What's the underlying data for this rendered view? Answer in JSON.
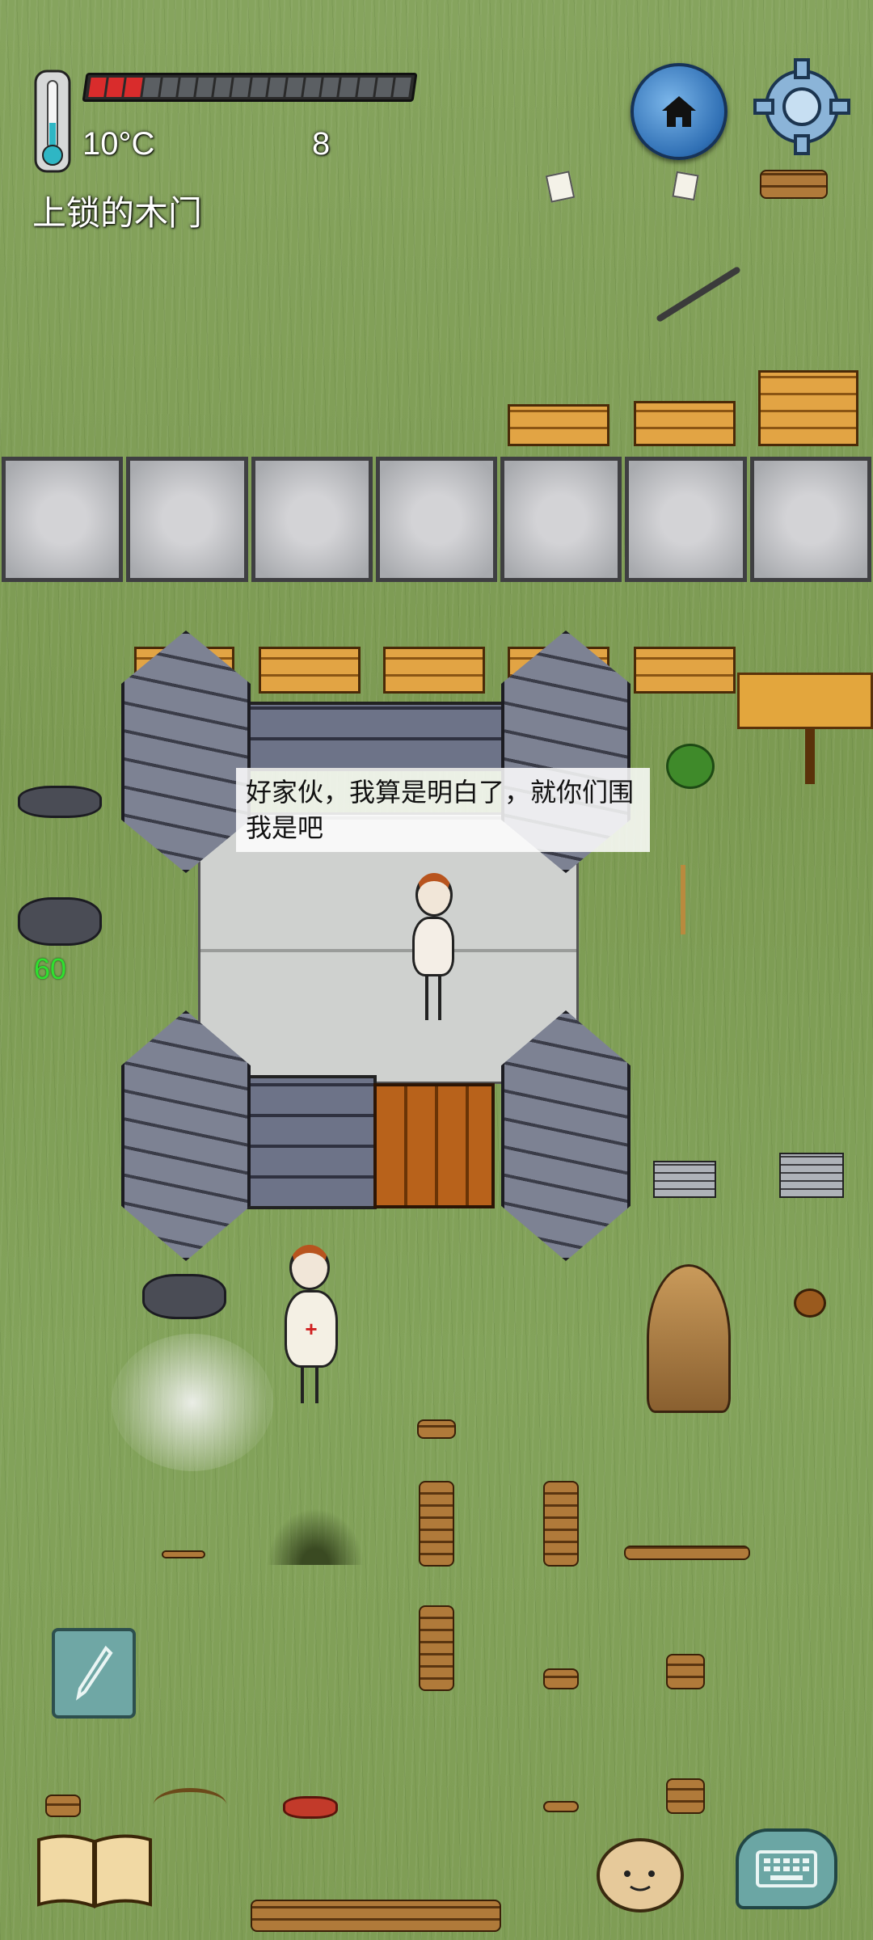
{
  "hud": {
    "temperature": "10°C",
    "count": "8",
    "object_name": "上锁的木门",
    "health_segments_total": 18,
    "health_segments_filled": 3
  },
  "dialog": {
    "speech": "好家伙，我算是明白了，就你们围我是吧"
  },
  "overlay": {
    "number": "60"
  },
  "icons": {
    "home": "home-icon",
    "settings": "gear-icon",
    "edit": "pencil-icon",
    "recipe_book": "book-icon",
    "emote": "face-icon",
    "chat": "keyboard-icon",
    "temperature": "thermometer-icon"
  },
  "colors": {
    "health_fill": "#d92c2c",
    "grass": "#7f9d55",
    "overlay_number": "#2fe02f"
  }
}
